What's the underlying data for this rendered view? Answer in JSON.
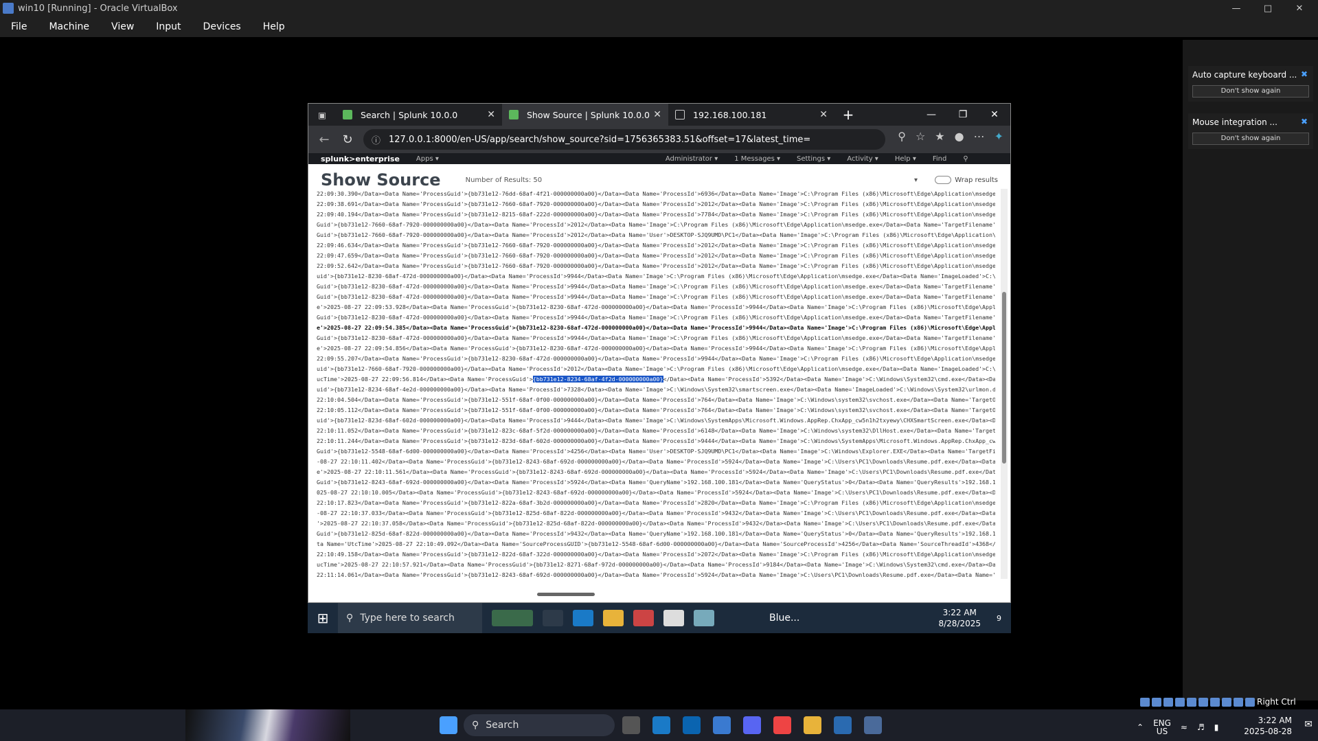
{
  "vbox": {
    "title": "win10 [Running] - Oracle VirtualBox",
    "menu": [
      "File",
      "Machine",
      "View",
      "Input",
      "Devices",
      "Help"
    ],
    "status_host_key": "Right Ctrl"
  },
  "notifications": [
    {
      "title": "Auto capture keyboard ...",
      "button": "Don't show again"
    },
    {
      "title": "Mouse integration ...",
      "button": "Don't show again"
    }
  ],
  "browser": {
    "tabs": [
      {
        "label": "Search | Splunk 10.0.0"
      },
      {
        "label": "Show Source | Splunk 10.0.0"
      },
      {
        "label": "192.168.100.181"
      }
    ],
    "url": "127.0.0.1:8000/en-US/app/search/show_source?sid=1756365383.51&offset=17&latest_time="
  },
  "splunk": {
    "logo": "splunk>enterprise",
    "nav": [
      "Apps ▾",
      "Administrator ▾",
      "1 Messages ▾",
      "Settings ▾",
      "Activity ▾",
      "Help ▾",
      "Find"
    ],
    "title": "Show Source",
    "count": "Number of Results: 50",
    "wrap": "Wrap results",
    "lines": [
      "22:09:30.390</Data><Data Name='ProcessGuid'>{bb731e12-76dd-68af-4f21-000000000a00}</Data><Data Name='ProcessId'>6936</Data><Data Name='Image'>C:\\Program Files (x86)\\Microsoft\\Edge\\Application\\msedge.",
      "22:09:38.691</Data><Data Name='ProcessGuid'>{bb731e12-7660-68af-7920-000000000a00}</Data><Data Name='ProcessId'>2012</Data><Data Name='Image'>C:\\Program Files (x86)\\Microsoft\\Edge\\Application\\msedge.",
      "22:09:40.194</Data><Data Name='ProcessGuid'>{bb731e12-8215-68af-222d-000000000a00}</Data><Data Name='ProcessId'>7784</Data><Data Name='Image'>C:\\Program Files (x86)\\Microsoft\\Edge\\Application\\msedge.",
      "Guid'>{bb731e12-7660-68af-7920-000000000a00}</Data><Data Name='ProcessId'>2012</Data><Data Name='Image'>C:\\Program Files (x86)\\Microsoft\\Edge\\Application\\msedge.exe</Data><Data Name='TargetFilename'>",
      "Guid'>{bb731e12-7660-68af-7920-000000000a00}</Data><Data Name='ProcessId'>2012</Data><Data Name='User'>DESKTOP-SJQ9UMD\\PC1</Data><Data Name='Image'>C:\\Program Files (x86)\\Microsoft\\Edge\\Application\\m",
      "22:09:46.634</Data><Data Name='ProcessGuid'>{bb731e12-7660-68af-7920-000000000a00}</Data><Data Name='ProcessId'>2012</Data><Data Name='Image'>C:\\Program Files (x86)\\Microsoft\\Edge\\Application\\msedge.",
      "22:09:47.659</Data><Data Name='ProcessGuid'>{bb731e12-7660-68af-7920-000000000a00}</Data><Data Name='ProcessId'>2012</Data><Data Name='Image'>C:\\Program Files (x86)\\Microsoft\\Edge\\Application\\msedge.",
      "22:09:52.642</Data><Data Name='ProcessGuid'>{bb731e12-7660-68af-7920-000000000a00}</Data><Data Name='ProcessId'>2012</Data><Data Name='Image'>C:\\Program Files (x86)\\Microsoft\\Edge\\Application\\msedge.",
      "uid'>{bb731e12-8230-68af-472d-000000000a00}</Data><Data Name='ProcessId'>9944</Data><Data Name='Image'>C:\\Program Files (x86)\\Microsoft\\Edge\\Application\\msedge.exe</Data><Data Name='ImageLoaded'>C:\\Wi",
      "Guid'>{bb731e12-8230-68af-472d-000000000a00}</Data><Data Name='ProcessId'>9944</Data><Data Name='Image'>C:\\Program Files (x86)\\Microsoft\\Edge\\Application\\msedge.exe</Data><Data Name='TargetFilename'>",
      "Guid'>{bb731e12-8230-68af-472d-000000000a00}</Data><Data Name='ProcessId'>9944</Data><Data Name='Image'>C:\\Program Files (x86)\\Microsoft\\Edge\\Application\\msedge.exe</Data><Data Name='TargetFilename'>",
      "e'>2025-08-27 22:09:53.928</Data><Data Name='ProcessGuid'>{bb731e12-8230-68af-472d-000000000a00}</Data><Data Name='ProcessId'>9944</Data><Data Name='Image'>C:\\Program Files (x86)\\Microsoft\\Edge\\Appli",
      "Guid'>{bb731e12-8230-68af-472d-000000000a00}</Data><Data Name='ProcessId'>9944</Data><Data Name='Image'>C:\\Program Files (x86)\\Microsoft\\Edge\\Application\\msedge.exe</Data><Data Name='TargetFilename'>",
      "e'>2025-08-27 22:09:54.385</Data><Data Name='ProcessGuid'>{bb731e12-8230-68af-472d-000000000a00}</Data><Data Name='ProcessId'>9944</Data><Data Name='Image'>C:\\Program Files (x86)\\Microsoft\\Edge\\Appli",
      "Guid'>{bb731e12-8230-68af-472d-000000000a00}</Data><Data Name='ProcessId'>9944</Data><Data Name='Image'>C:\\Program Files (x86)\\Microsoft\\Edge\\Application\\msedge.exe</Data><Data Name='TargetFilename'>",
      "e'>2025-08-27 22:09:54.856</Data><Data Name='ProcessGuid'>{bb731e12-8230-68af-472d-000000000a00}</Data><Data Name='ProcessId'>9944</Data><Data Name='Image'>C:\\Program Files (x86)\\Microsoft\\Edge\\Appli",
      "22:09:55.207</Data><Data Name='ProcessGuid'>{bb731e12-8230-68af-472d-000000000a00}</Data><Data Name='ProcessId'>9944</Data><Data Name='Image'>C:\\Program Files (x86)\\Microsoft\\Edge\\Application\\msedge.",
      "uid'>{bb731e12-7660-68af-7920-000000000a00}</Data><Data Name='ProcessId'>2012</Data><Data Name='Image'>C:\\Program Files (x86)\\Microsoft\\Edge\\Application\\msedge.exe</Data><Data Name='ImageLoaded'>C:\\Wi",
      "ucTime'>2025-08-27 22:09:56.814</Data><Data Name='ProcessGuid'>",
      "uid'>{bb731e12-8234-68af-4e2d-000000000a00}</Data><Data Name='ProcessId'>7328</Data><Data Name='Image'>C:\\Windows\\System32\\smartscreen.exe</Data><Data Name='ImageLoaded'>C:\\Windows\\System32\\urlmon.dll",
      "22:10:04.504</Data><Data Name='ProcessGuid'>{bb731e12-551f-68af-0f00-000000000a00}</Data><Data Name='ProcessId'>764</Data><Data Name='Image'>C:\\Windows\\system32\\svchost.exe</Data><Data Name='TargetOb",
      "22:10:05.112</Data><Data Name='ProcessGuid'>{bb731e12-551f-68af-0f00-000000000a00}</Data><Data Name='ProcessId'>764</Data><Data Name='Image'>C:\\Windows\\system32\\svchost.exe</Data><Data Name='TargetOb",
      "uid'>{bb731e12-823d-68af-602d-000000000a00}</Data><Data Name='ProcessId'>9444</Data><Data Name='Image'>C:\\Windows\\SystemApps\\Microsoft.Windows.AppRep.ChxApp_cw5n1h2txyewy\\CHXSmartScreen.exe</Data><Dat",
      "22:10:11.052</Data><Data Name='ProcessGuid'>{bb731e12-823c-68af-5f2d-000000000a00}</Data><Data Name='ProcessId'>6148</Data><Data Name='Image'>C:\\Windows\\system32\\DllHost.exe</Data><Data Name='TargetO",
      "22:10:11.244</Data><Data Name='ProcessGuid'>{bb731e12-823d-68af-602d-000000000a00}</Data><Data Name='ProcessId'>9444</Data><Data Name='Image'>C:\\Windows\\SystemApps\\Microsoft.Windows.AppRep.ChxApp_cw5",
      "Guid'>{bb731e12-5548-68af-6d00-000000000a00}</Data><Data Name='ProcessId'>4256</Data><Data Name='User'>DESKTOP-SJQ9UMD\\PC1</Data><Data Name='Image'>C:\\Windows\\Explorer.EXE</Data><Data Name='TargetFil",
      "-08-27 22:10:11.402</Data><Data Name='ProcessGuid'>{bb731e12-8243-68af-692d-000000000a00}</Data><Data Name='ProcessId'>5924</Data><Data Name='Image'>C:\\Users\\PC1\\Downloads\\Resume.pdf.exe</Data><Data",
      "e'>2025-08-27 22:10:11.561</Data><Data Name='ProcessGuid'>{bb731e12-8243-68af-692d-000000000a00}</Data><Data Name='ProcessId'>5924</Data><Data Name='Image'>C:\\Users\\PC1\\Downloads\\Resume.pdf.exe</Data>",
      "Guid'>{bb731e12-8243-68af-692d-000000000a00}</Data><Data Name='ProcessId'>5924</Data><Data Name='QueryName'>192.168.100.181</Data><Data Name='QueryStatus'>0</Data><Data Name='QueryResults'>192.168.10",
      "025-08-27 22:10:10.005</Data><Data Name='ProcessGuid'>{bb731e12-8243-68af-692d-000000000a00}</Data><Data Name='ProcessId'>5924</Data><Data Name='Image'>C:\\Users\\PC1\\Downloads\\Resume.pdf.exe</Data><Da",
      "22:10:17.823</Data><Data Name='ProcessGuid'>{bb731e12-822a-68af-3b2d-000000000a00}</Data><Data Name='ProcessId'>2820</Data><Data Name='Image'>C:\\Program Files (x86)\\Microsoft\\Edge\\Application\\msedge.",
      "-08-27 22:10:37.033</Data><Data Name='ProcessGuid'>{bb731e12-825d-68af-822d-000000000a00}</Data><Data Name='ProcessId'>9432</Data><Data Name='Image'>C:\\Users\\PC1\\Downloads\\Resume.pdf.exe</Data><Data",
      "'>2025-08-27 22:10:37.058</Data><Data Name='ProcessGuid'>{bb731e12-825d-68af-822d-000000000a00}</Data><Data Name='ProcessId'>9432</Data><Data Name='Image'>C:\\Users\\PC1\\Downloads\\Resume.pdf.exe</Data>",
      "Guid'>{bb731e12-825d-68af-822d-000000000a00}</Data><Data Name='ProcessId'>9432</Data><Data Name='QueryName'>192.168.100.181</Data><Data Name='QueryStatus'>0</Data><Data Name='QueryResults'>192.168.10",
      "ta Name='UtcTime'>2025-08-27 22:10:49.092</Data><Data Name='SourceProcessGUID'>{bb731e12-5548-68af-6d00-000000000a00}</Data><Data Name='SourceProcessId'>4256</Data><Data Name='SourceThreadId'>4368</D",
      "22:10:49.158</Data><Data Name='ProcessGuid'>{bb731e12-822d-68af-322d-000000000a00}</Data><Data Name='ProcessId'>2072</Data><Data Name='Image'>C:\\Program Files (x86)\\Microsoft\\Edge\\Application\\msedge.",
      "ucTime'>2025-08-27 22:10:57.921</Data><Data Name='ProcessGuid'>{bb731e12-8271-68af-972d-000000000a00}</Data><Data Name='ProcessId'>9184</Data><Data Name='Image'>C:\\Windows\\System32\\cmd.exe</Data><Data",
      "22:11:14.061</Data><Data Name='ProcessGuid'>{bb731e12-8243-68af-692d-000000000a00}</Data><Data Name='ProcessId'>5924</Data><Data Name='Image'>C:\\Users\\PC1\\Downloads\\Resume.pdf.exe</Data><Data Name='T"
    ],
    "highlight": "{bb731e12-8234-68af-4f2d-000000000a00}",
    "highlight_tail": "</Data><Data Name='ProcessId'>5392</Data><Data Name='Image'>C:\\Windows\\System32\\cmd.exe</Data><Data"
  },
  "guest_taskbar": {
    "search": "Type here to search",
    "weather": "Blue...",
    "time": "3:22 AM",
    "date": "8/28/2025",
    "badge": "9"
  },
  "host_taskbar": {
    "search": "Search",
    "lang": "ENG",
    "region": "US",
    "time": "3:22 AM",
    "date": "2025-08-28"
  }
}
